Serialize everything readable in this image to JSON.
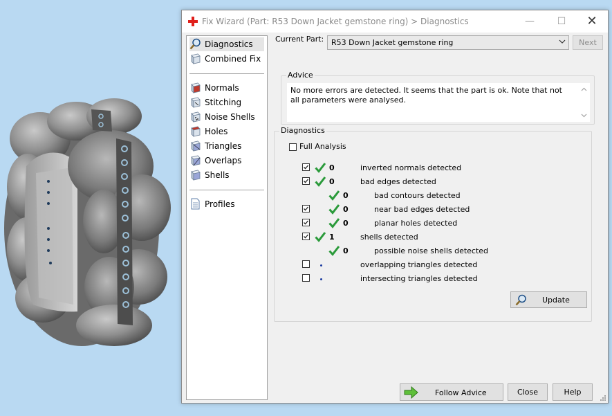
{
  "window": {
    "title": "Fix Wizard (Part: R53 Down Jacket gemstone ring) > Diagnostics",
    "min_icon": "minimize-icon",
    "max_icon": "maximize-icon",
    "close_icon": "close-icon"
  },
  "nav": {
    "items": [
      {
        "label": "Diagnostics",
        "icon": "magnifier-icon",
        "selected": true
      },
      {
        "label": "Combined Fix",
        "icon": "cube-icon"
      },
      {
        "label": "Normals",
        "icon": "cube-normals-icon"
      },
      {
        "label": "Stitching",
        "icon": "cube-stitching-icon"
      },
      {
        "label": "Noise Shells",
        "icon": "cube-noise-icon"
      },
      {
        "label": "Holes",
        "icon": "cube-holes-icon"
      },
      {
        "label": "Triangles",
        "icon": "cube-triangles-icon"
      },
      {
        "label": "Overlaps",
        "icon": "cube-overlaps-icon"
      },
      {
        "label": "Shells",
        "icon": "cube-shells-icon"
      },
      {
        "label": "Profiles",
        "icon": "document-icon"
      }
    ]
  },
  "header": {
    "current_part_label": "Current Part:",
    "current_part_value": "R53 Down Jacket gemstone ring",
    "next_label": "Next"
  },
  "advice": {
    "title": "Advice",
    "text": "No more errors are detected. It seems that the part is ok. Note that not all parameters were analysed."
  },
  "diagnostics": {
    "title": "Diagnostics",
    "full_analysis_label": "Full Analysis",
    "full_analysis_checked": false,
    "rows": [
      {
        "checkbox": true,
        "checked": true,
        "status": "ok",
        "count": "0",
        "text": "inverted normals detected",
        "indent": 0
      },
      {
        "checkbox": true,
        "checked": true,
        "status": "ok",
        "count": "0",
        "text": "bad edges detected",
        "indent": 0
      },
      {
        "checkbox": false,
        "checked": false,
        "status": "ok",
        "count": "0",
        "text": "bad contours detected",
        "indent": 1
      },
      {
        "checkbox": true,
        "checked": true,
        "status": "ok",
        "count": "0",
        "text": "near bad edges detected",
        "indent": 1
      },
      {
        "checkbox": true,
        "checked": true,
        "status": "ok",
        "count": "0",
        "text": "planar holes detected",
        "indent": 1
      },
      {
        "checkbox": true,
        "checked": true,
        "status": "ok",
        "count": "1",
        "text": "shells detected",
        "indent": 0
      },
      {
        "checkbox": false,
        "checked": false,
        "status": "ok",
        "count": "0",
        "text": "possible noise shells detected",
        "indent": 1
      },
      {
        "checkbox": true,
        "checked": false,
        "status": "none",
        "count": "",
        "text": "overlapping triangles detected",
        "indent": 0
      },
      {
        "checkbox": true,
        "checked": false,
        "status": "none",
        "count": "",
        "text": "intersecting triangles detected",
        "indent": 0
      }
    ],
    "update_label": "Update"
  },
  "footer": {
    "follow_advice_label": "Follow Advice",
    "close_label": "Close",
    "help_label": "Help"
  },
  "colors": {
    "desktop": "#b9d9f2",
    "check_green": "#2a9a3a",
    "app_icon_red": "#e0201c"
  }
}
